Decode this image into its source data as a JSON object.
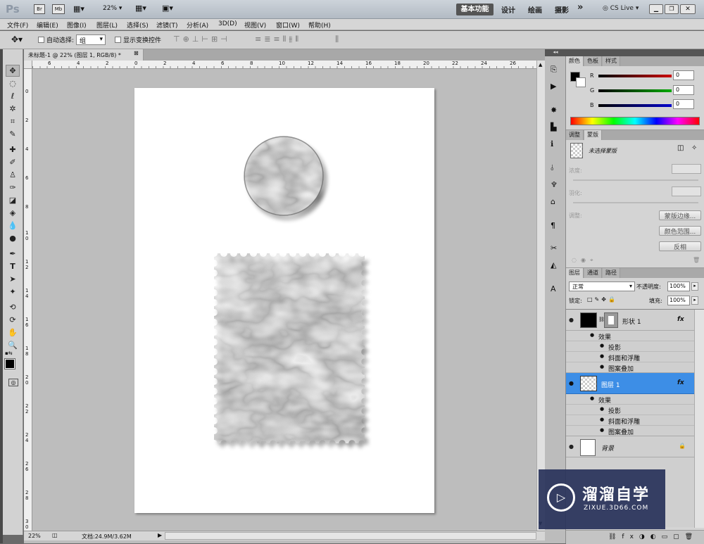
{
  "titlebar": {
    "ps_logo": "Ps",
    "br": "Br",
    "mb": "Mb",
    "zoom": "22%",
    "workspaces": [
      "基本功能",
      "设计",
      "绘画",
      "摄影"
    ],
    "more": "»",
    "cslive": "CS Live"
  },
  "menu": [
    "文件(F)",
    "编辑(E)",
    "图像(I)",
    "图层(L)",
    "选择(S)",
    "滤镜(T)",
    "分析(A)",
    "3D(D)",
    "视图(V)",
    "窗口(W)",
    "帮助(H)"
  ],
  "options": {
    "auto_select_label": "自动选择:",
    "auto_select_value": "组",
    "show_transform_label": "显示变换控件"
  },
  "document": {
    "tab_title": "未标题-1 @ 22% (图层 1, RGB/8) *",
    "ruler_h": [
      "6",
      "4",
      "2",
      "0",
      "2",
      "4",
      "6",
      "8",
      "10",
      "12",
      "14",
      "16",
      "18",
      "20",
      "22",
      "24",
      "26"
    ],
    "ruler_v": [
      "0",
      "2",
      "4",
      "6",
      "8",
      "1\n0",
      "1\n2",
      "1\n4",
      "1\n6",
      "1\n8",
      "2\n0",
      "2\n2",
      "2\n4",
      "2\n6",
      "2\n8",
      "3\n0"
    ]
  },
  "status": {
    "zoom": "22%",
    "doc_info": "文档:24.9M/3.62M"
  },
  "color_panel": {
    "tabs": [
      "颜色",
      "色板",
      "样式"
    ],
    "channels": [
      {
        "label": "R",
        "value": "0",
        "color": "#cc0000"
      },
      {
        "label": "G",
        "value": "0",
        "color": "#00aa00"
      },
      {
        "label": "B",
        "value": "0",
        "color": "#0000cc"
      }
    ]
  },
  "mask_panel": {
    "tabs": [
      "调整",
      "蒙版"
    ],
    "no_mask": "未选择蒙版",
    "density": "浓度:",
    "feather": "羽化:",
    "refine": "调整:",
    "btn_edge": "蒙版边缘...",
    "btn_color_range": "颜色范围...",
    "btn_invert": "反相"
  },
  "layers_panel": {
    "tabs": [
      "图层",
      "通道",
      "路径"
    ],
    "blend_mode": "正常",
    "opacity_label": "不透明度:",
    "opacity": "100%",
    "lock_label": "锁定:",
    "fill_label": "填充:",
    "fill": "100%",
    "layers": [
      {
        "name": "形状 1",
        "fx": "fx",
        "effects_label": "效果",
        "effects": [
          "投影",
          "斜面和浮雕",
          "图案叠加"
        ],
        "selected": false
      },
      {
        "name": "图层 1",
        "fx": "fx",
        "effects_label": "效果",
        "effects": [
          "投影",
          "斜面和浮雕",
          "图案叠加"
        ],
        "selected": true
      },
      {
        "name": "背景",
        "selected": false
      }
    ]
  },
  "watermark": {
    "title": "溜溜自学",
    "url": "ZIXUE.3D66.COM"
  }
}
